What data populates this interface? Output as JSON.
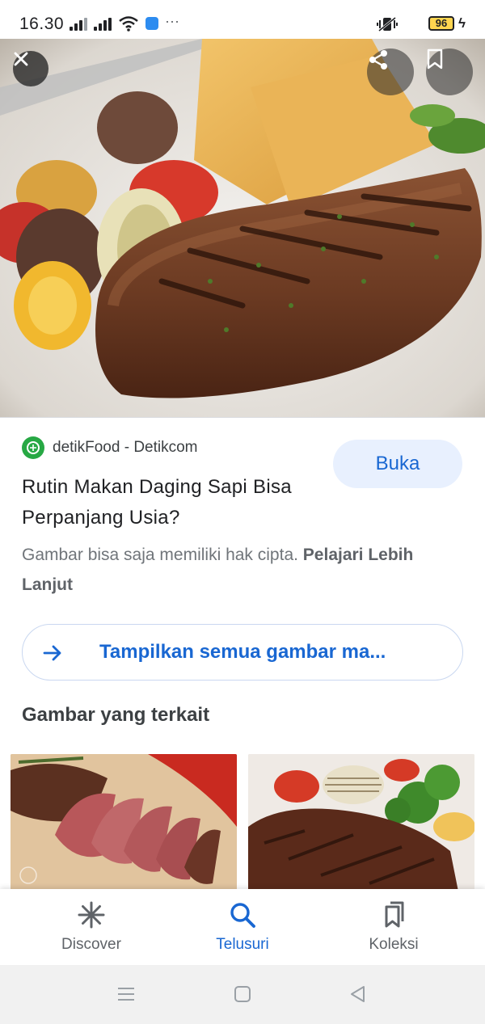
{
  "status_bar": {
    "time": "16.30",
    "battery": "96",
    "overflow": "···",
    "icons": [
      "signal-icon",
      "signal-icon",
      "wifi-icon",
      "app-notification-icon",
      "vibrate-icon",
      "battery-icon",
      "charging-icon"
    ]
  },
  "hero": {
    "icons": {
      "close": "close-icon",
      "share": "share-icon",
      "save": "bookmark-icon"
    }
  },
  "source": {
    "name": "detikFood - Detikcom",
    "open_label": "Buka"
  },
  "result": {
    "title": "Rutin Makan Daging Sapi Bisa Perpanjang Usia?",
    "notice_text": "Gambar bisa saja memiliki hak cipta. ",
    "learn_more": "Pelajari Lebih Lanjut"
  },
  "see_all": {
    "label": "Tampilkan semua gambar ma..."
  },
  "related": {
    "heading": "Gambar yang terkait"
  },
  "bottom_nav": {
    "items": [
      {
        "label": "Discover",
        "icon": "asterisk-icon",
        "active": false
      },
      {
        "label": "Telusuri",
        "icon": "search-icon",
        "active": true
      },
      {
        "label": "Koleksi",
        "icon": "collections-icon",
        "active": false
      }
    ]
  },
  "system_nav": {
    "icons": [
      "menu-icon",
      "home-icon",
      "back-icon"
    ]
  },
  "colors": {
    "accent": "#1967d2",
    "open_button_bg": "#e8f0fe",
    "source_logo": "#27a844",
    "battery": "#ffd54f"
  }
}
